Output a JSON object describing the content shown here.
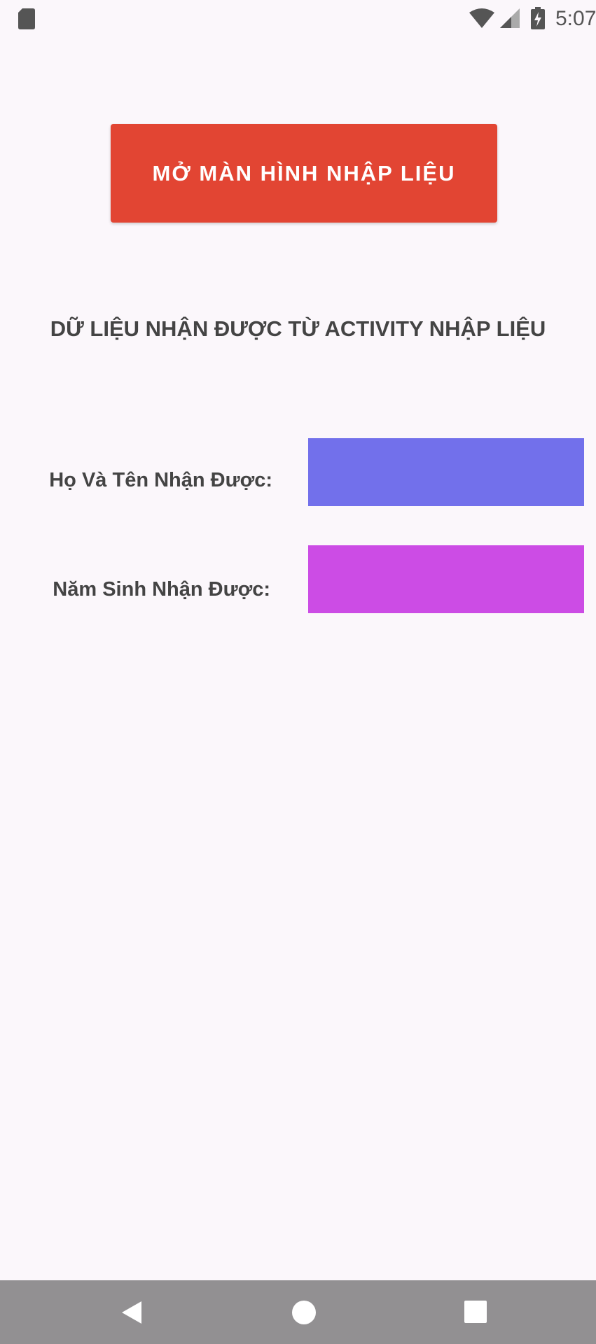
{
  "status_bar": {
    "time": "5:07",
    "icons": [
      "sd-card-icon",
      "wifi-icon",
      "signal-icon",
      "battery-icon"
    ]
  },
  "main": {
    "open_button_label": "MỞ MÀN HÌNH NHẬP LIỆU",
    "section_title": "DỮ LIỆU NHẬN ĐƯỢC TỪ ACTIVITY NHẬP LIỆU",
    "fields": [
      {
        "label": "Họ Và Tên Nhận Được:",
        "value": "",
        "color": "#7270eb"
      },
      {
        "label": "Năm Sinh Nhận Được:",
        "value": "",
        "color": "#cc4ce5"
      }
    ]
  },
  "colors": {
    "accent": "#e24533",
    "background": "#fbf7fb",
    "nav_bar": "#929092"
  },
  "nav_bar": {
    "icons": [
      "back-icon",
      "home-icon",
      "recent-apps-icon"
    ]
  }
}
